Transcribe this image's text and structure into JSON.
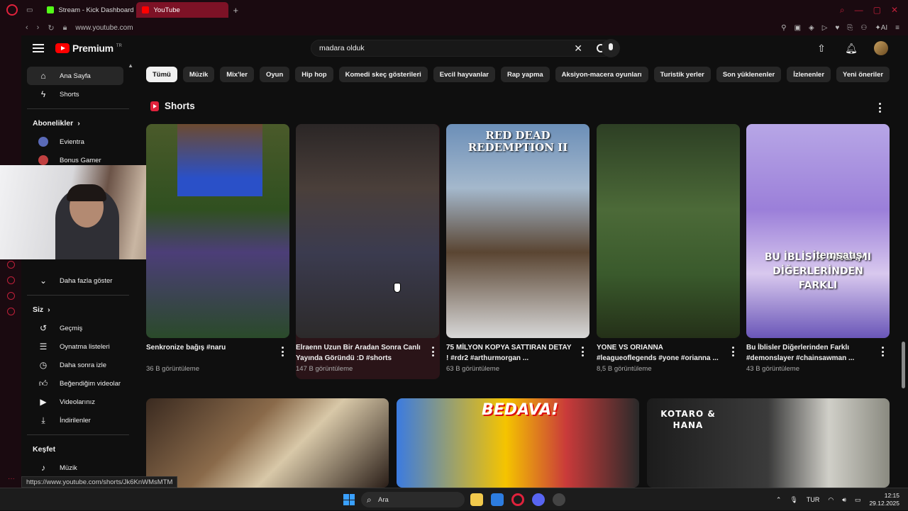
{
  "browser": {
    "tabs": [
      {
        "label": "Stream - Kick Dashboard",
        "color": "#53fc18"
      },
      {
        "label": "YouTube",
        "color": "#ff0000"
      }
    ],
    "url": "www.youtube.com"
  },
  "masthead": {
    "logo_text": "Premium",
    "logo_sup": "TR",
    "search_value": "madara olduk"
  },
  "sidebar": {
    "main": [
      {
        "label": "Ana Sayfa",
        "icon": "home-icon"
      },
      {
        "label": "Shorts",
        "icon": "shorts-icon"
      }
    ],
    "subs_heading": "Abonelikler",
    "subs": [
      {
        "label": "Evientra",
        "color": "#5a6ab8"
      },
      {
        "label": "Bonus Gamer",
        "color": "#c04040"
      }
    ],
    "more_label": "Daha fazla göster",
    "you_heading": "Siz",
    "you": [
      {
        "label": "Geçmiş",
        "icon": "history-icon"
      },
      {
        "label": "Oynatma listeleri",
        "icon": "playlist-icon"
      },
      {
        "label": "Daha sonra izle",
        "icon": "clock-icon"
      },
      {
        "label": "Beğendiğim videolar",
        "icon": "like-icon"
      },
      {
        "label": "Videolarınız",
        "icon": "video-icon"
      },
      {
        "label": "İndirilenler",
        "icon": "download-icon"
      }
    ],
    "explore_heading": "Keşfet",
    "explore": [
      {
        "label": "Müzik",
        "icon": "music-icon"
      }
    ]
  },
  "chips": [
    "Tümü",
    "Müzik",
    "Mix'ler",
    "Oyun",
    "Hip hop",
    "Komedi skeç gösterileri",
    "Evcil hayvanlar",
    "Rap yapma",
    "Aksiyon-macera oyunları",
    "Turistik yerler",
    "Son yüklenenler",
    "İzlenenler",
    "Yeni öneriler"
  ],
  "shorts": {
    "heading": "Shorts",
    "items": [
      {
        "title": "Senkronize bağış #naru",
        "views": "36 B görüntüleme"
      },
      {
        "title": "Elraenn Uzun Bir Aradan Sonra Canlı Yayında Göründü :D #shorts",
        "views": "147 B görüntüleme"
      },
      {
        "title": "75 MİLYON KOPYA SATTIRAN DETAY ! #rdr2  #arthurmorgan ...",
        "views": "63 B görüntüleme",
        "thumb_text": "RED DEAD REDEMPTION II"
      },
      {
        "title": "YONE VS ORIANNA #leagueoflegends #yone #orianna ...",
        "views": "8,5 B görüntüleme"
      },
      {
        "title": "Bu İblisler Diğerlerinden Farklı #demonslayer #chainsawman ...",
        "views": "43 B görüntüleme",
        "thumb_text": "BU İBLİSİN ANLAMI DİĞERLERİNDEN FARKLI"
      }
    ]
  },
  "watermark": "itemsatış",
  "videos": [
    {
      "thumb_text": ""
    },
    {
      "thumb_text": "BEDAVA!"
    },
    {
      "thumb_text": "KOTARO & HANA"
    }
  ],
  "status_url": "https://www.youtube.com/shorts/Jk6KnWMsMTM",
  "taskbar": {
    "search_placeholder": "Ara",
    "lang": "TUR",
    "time": "12:15",
    "date": "29.12.2025"
  }
}
